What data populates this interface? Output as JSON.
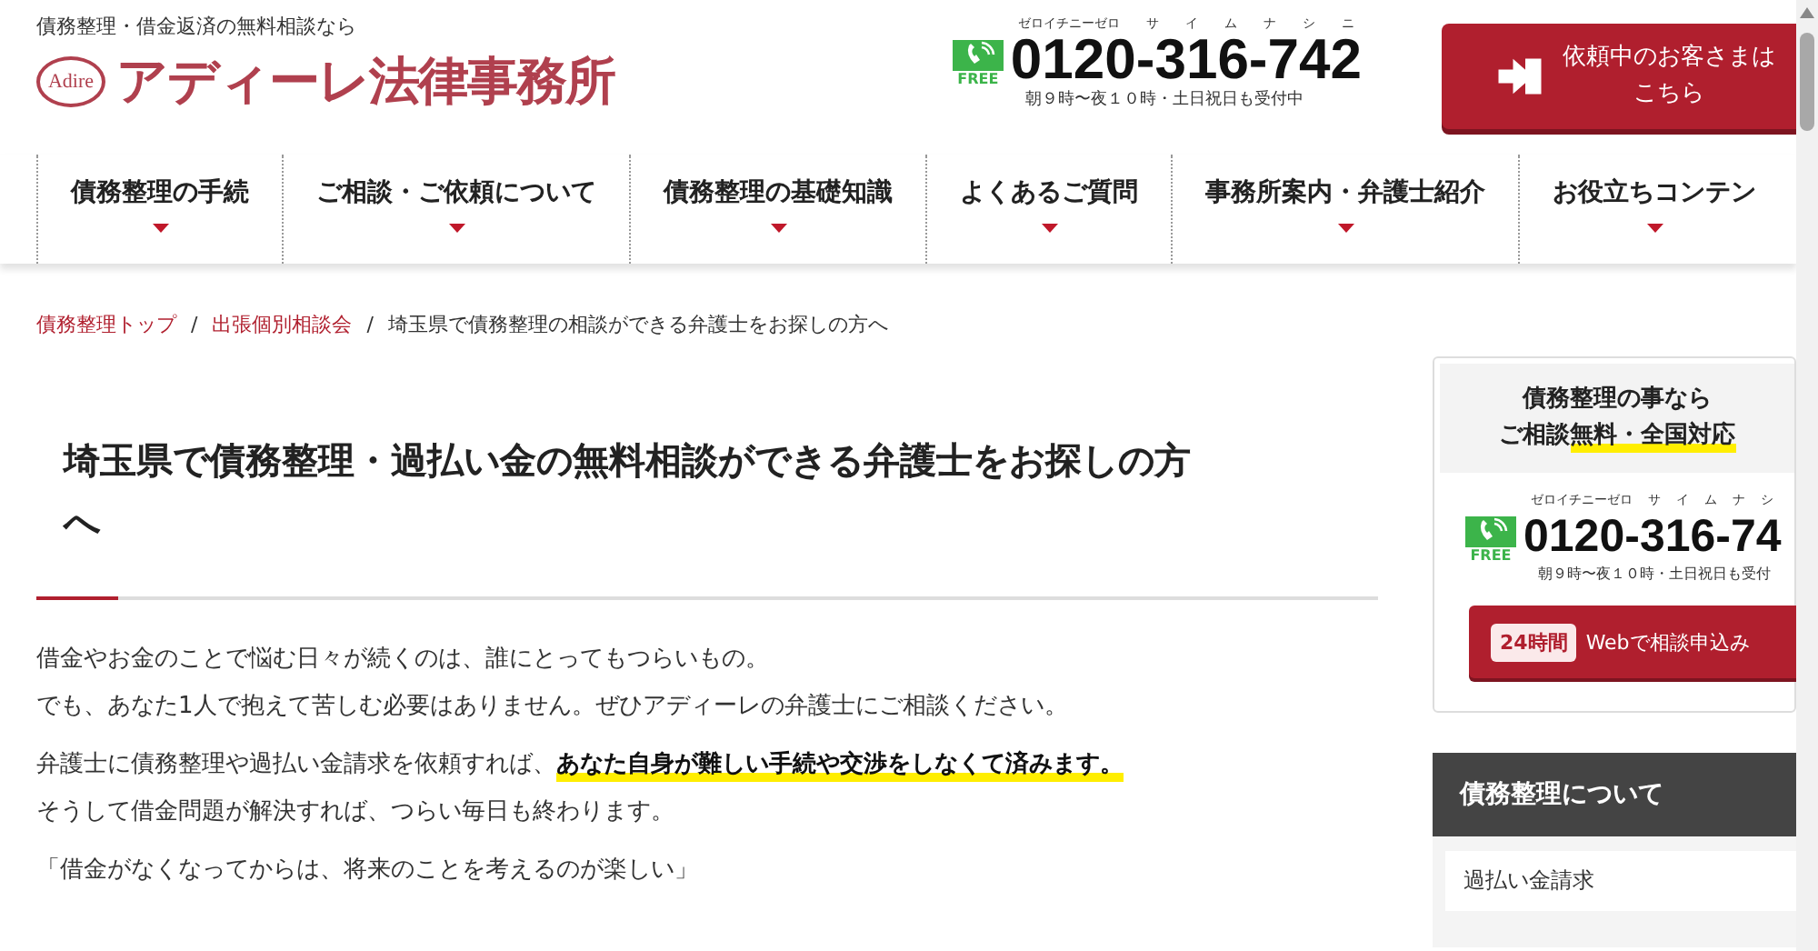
{
  "header": {
    "tagline": "債務整理・借金返済の無料相談なら",
    "logo_mark": "Adire",
    "logo_text": "アディーレ法律事務所",
    "phone": {
      "badge": "FREE",
      "ruby": [
        "ゼロイチニーゼロ",
        "サ",
        "イ",
        "ム",
        "ナ",
        "シ",
        "ニ"
      ],
      "number": "0120-316-742",
      "hours": "朝９時〜夜１０時・土日祝日も受付中"
    },
    "client_button": [
      "依頼中のお客さまは",
      "こちら"
    ]
  },
  "nav": [
    "債務整理の手続",
    "ご相談・ご依頼について",
    "債務整理の基礎知識",
    "よくあるご質問",
    "事務所案内・弁護士紹介",
    "お役立ちコンテン"
  ],
  "breadcrumb": [
    {
      "label": "債務整理トップ",
      "link": true
    },
    {
      "separator": "/",
      "label": "出張個別相談会",
      "link": true
    },
    {
      "separator": "/",
      "label": "埼玉県で債務整理の相談ができる弁護士をお探しの方へ",
      "link": false
    }
  ],
  "article": {
    "title": "埼玉県で債務整理・過払い金の無料相談ができる弁護士をお探しの方へ",
    "paragraphs": [
      [
        "借金やお金のことで悩む日々が続くのは、誰にとってもつらいもの。",
        "でも、あなた1人で抱えて苦しむ必要はありません。ぜひアディーレの弁護士にご相談ください。"
      ],
      [
        "弁護士に債務整理や過払い金請求を依頼すれば、**あなた自身が難しい手続や交渉をしなくて済みます。**",
        "そうして借金問題が解決すれば、つらい毎日も終わります。"
      ],
      [
        "「借金がなくなってからは、将来のことを考えるのが楽しい」"
      ]
    ]
  },
  "sidebar": {
    "title": [
      "債務整理の事なら",
      "ご相談**無料・全国対応**"
    ],
    "phone": {
      "badge": "FREE",
      "ruby": [
        "ゼロイチニーゼロ",
        "サ",
        "イ",
        "ム",
        "ナ",
        "シ"
      ],
      "number": "0120-316-74",
      "hours": "朝９時〜夜１０時・土日祝日も受付"
    },
    "web_button": {
      "tag": "24時間",
      "label": "Webで相談申込み"
    },
    "menu_title": "債務整理について",
    "menu_items": [
      "過払い金請求"
    ]
  }
}
